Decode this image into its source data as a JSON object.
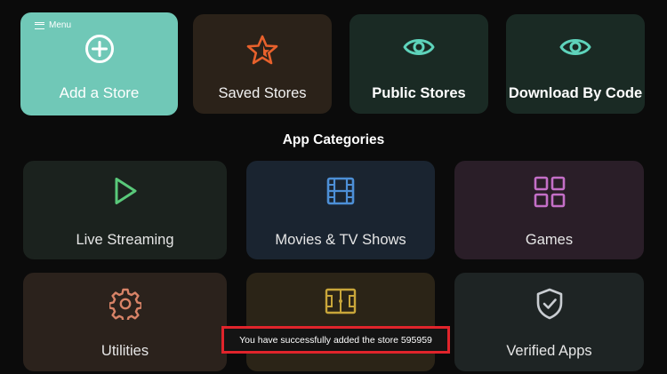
{
  "menu": {
    "label": "Menu",
    "icon": "hamburger-icon"
  },
  "top_cards": [
    {
      "label": "Add a Store",
      "icon": "plus-circle-icon"
    },
    {
      "label": "Saved Stores",
      "icon": "star-icon"
    },
    {
      "label": "Public Stores",
      "icon": "eye-icon"
    },
    {
      "label": "Download By Code",
      "icon": "eye-icon"
    }
  ],
  "section_title": "App Categories",
  "categories": [
    {
      "label": "Live Streaming",
      "icon": "play-icon"
    },
    {
      "label": "Movies & TV Shows",
      "icon": "film-icon"
    },
    {
      "label": "Games",
      "icon": "grid-icon"
    },
    {
      "label": "Utilities",
      "icon": "gear-icon"
    },
    {
      "label": "",
      "icon": "sports-field-icon"
    },
    {
      "label": "Verified Apps",
      "icon": "shield-check-icon"
    }
  ],
  "toast": {
    "message": "You have successfully added the store 595959"
  },
  "colors": {
    "accent": "#70c8b7",
    "teal_icon": "#5ed3bb",
    "orange_icon": "#e8612c",
    "toast_border": "#e0242b"
  }
}
